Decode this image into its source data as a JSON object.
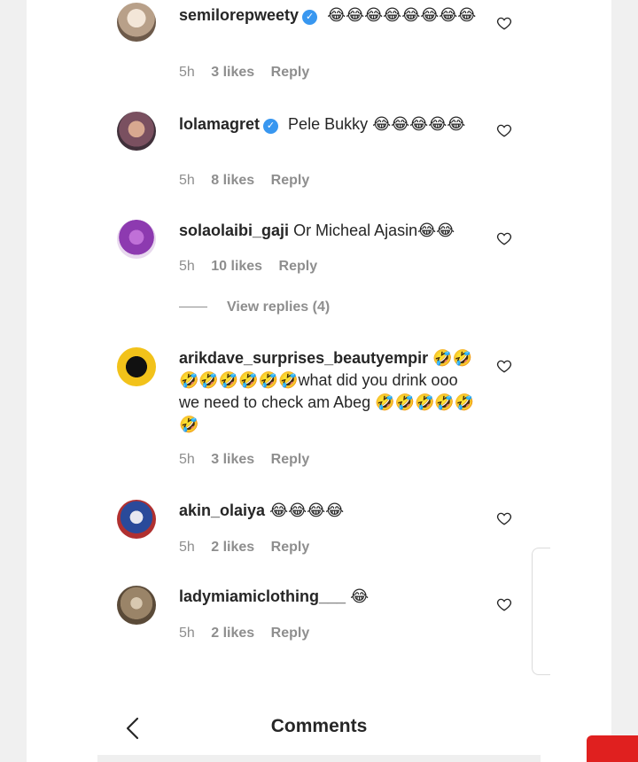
{
  "comments": [
    {
      "username": "semilorepweety",
      "verified": true,
      "text": "😂😂😂😂😂😂😂😂",
      "time": "5h",
      "likes": "3 likes",
      "reply": "Reply",
      "avatar_color": "#c9b8a6"
    },
    {
      "username": "lolamagret",
      "verified": true,
      "text": "Pele Bukky 😂😂😂😂😂",
      "time": "5h",
      "likes": "8 likes",
      "reply": "Reply",
      "avatar_color": "#8a6a70"
    },
    {
      "username": "solaolaibi_gaji",
      "verified": false,
      "text": "Or Micheal Ajasin😂😂",
      "time": "5h",
      "likes": "10 likes",
      "reply": "Reply",
      "avatar_color": "#8d3ab0"
    },
    {
      "username": "arikdave_surprises_beautyempir",
      "verified": false,
      "text": "🤣🤣🤣🤣🤣🤣🤣🤣what did you drink ooo we need to check am Abeg 🤣🤣🤣🤣🤣🤣",
      "time": "5h",
      "likes": "3 likes",
      "reply": "Reply",
      "avatar_color": "#f2c21a"
    },
    {
      "username": "akin_olaiya",
      "verified": false,
      "text": "😂😂😂😂",
      "time": "5h",
      "likes": "2 likes",
      "reply": "Reply",
      "avatar_color": "#2a4a9a"
    },
    {
      "username": "ladymiamiclothing___",
      "verified": false,
      "text": "😂",
      "time": "5h",
      "likes": "2 likes",
      "reply": "Reply",
      "avatar_color": "#7a6a55"
    }
  ],
  "view_replies": "View replies (4)",
  "header": {
    "title": "Comments"
  },
  "accent": "#3897f0",
  "icons": {
    "like": "heart-outline-icon",
    "back": "chevron-left-icon",
    "verified": "verified-badge-icon"
  }
}
